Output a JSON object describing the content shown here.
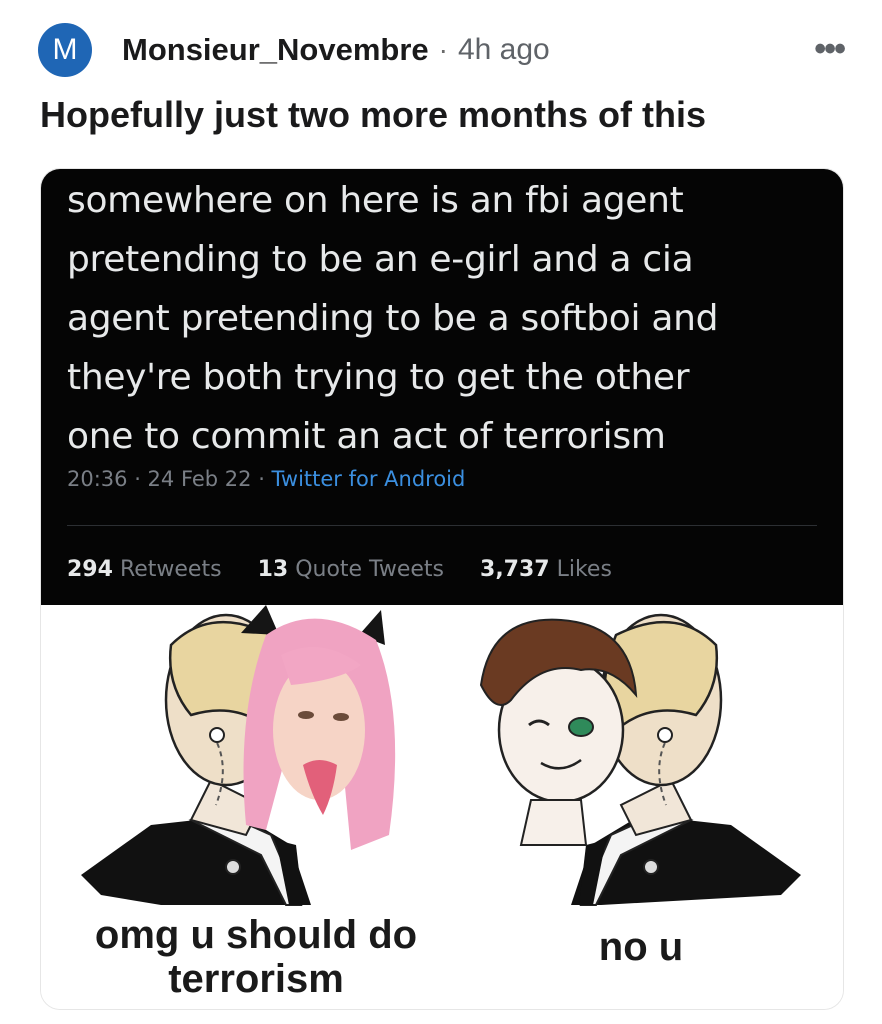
{
  "post": {
    "avatar_letter": "M",
    "author": "Monsieur_Novembre",
    "separator": "·",
    "time": "4h ago",
    "more_icon": "more-horizontal-icon",
    "title": "Hopefully just two more months of this"
  },
  "tweet": {
    "lines": [
      "somewhere on here is an fbi agent",
      "pretending to be an e-girl and a cia",
      "agent pretending to be a softboi and",
      "they're both trying to get the other",
      "one to commit an act of terrorism"
    ],
    "timestamp": "20:36 · 24 Feb 22 · ",
    "source": "Twitter for Android",
    "retweets_count": "294",
    "retweets_label": "Retweets",
    "quotes_count": "13",
    "quotes_label": "Quote Tweets",
    "likes_count": "3,737",
    "likes_label": "Likes"
  },
  "meme": {
    "left_caption_line1": "omg u should do",
    "left_caption_line2": "terrorism",
    "right_caption": "no u"
  },
  "colors": {
    "avatar_bg": "#1f66b5",
    "tweet_bg": "#050505",
    "link_blue": "#3b8fe0"
  }
}
